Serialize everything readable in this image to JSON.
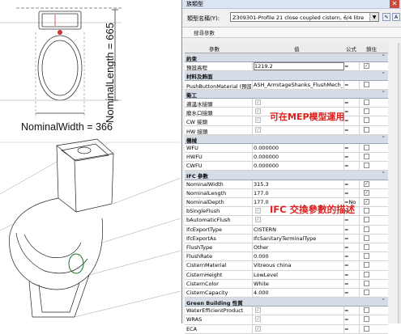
{
  "cad": {
    "nominal_length_label": "NominalLength = 665",
    "nominal_width_label": "NominalWidth = 366"
  },
  "dialog": {
    "title": "族類型",
    "close_glyph": "✕",
    "type_label": "類型名稱(Y):",
    "type_value": "Z309301-Profile 21 close coupled cistern, 6/4 litre",
    "toolbar_label": "搜尋參數",
    "columns": [
      "參數",
      "值",
      "公式",
      "鎖住"
    ]
  },
  "rows": [
    {
      "kind": "group",
      "label": "約束"
    },
    {
      "kind": "param",
      "name": "預設高程",
      "value": "1219.2",
      "formula": "=",
      "lock": true,
      "selected": true
    },
    {
      "kind": "group",
      "label": "材料及飾面"
    },
    {
      "kind": "param",
      "name": "PushButtonMaterial (預設)",
      "value": "ASH_ArmitageShanks_FlushMech_",
      "formula": "=",
      "lock": false
    },
    {
      "kind": "group",
      "label": "衛工"
    },
    {
      "kind": "param",
      "name": "適溫水接頭",
      "valuecb": true,
      "formula": "=",
      "lock": false
    },
    {
      "kind": "param",
      "name": "廢水口接頭",
      "valuecb": true,
      "formula": "=",
      "lock": false
    },
    {
      "kind": "param",
      "name": "CW 接頭",
      "valuecb": true,
      "formula": "=",
      "lock": false
    },
    {
      "kind": "param",
      "name": "HW 接頭",
      "valuecb": true,
      "formula": "=",
      "lock": false
    },
    {
      "kind": "group",
      "label": "機械"
    },
    {
      "kind": "param",
      "name": "WFU",
      "value": "0.000000",
      "formula": "=",
      "lock": false
    },
    {
      "kind": "param",
      "name": "HWFU",
      "value": "0.000000",
      "formula": "=",
      "lock": false
    },
    {
      "kind": "param",
      "name": "CWFU",
      "value": "0.000000",
      "formula": "=",
      "lock": false
    },
    {
      "kind": "group",
      "label": "IFC 參數"
    },
    {
      "kind": "param",
      "name": "NominalWidth",
      "value": "315.3",
      "formula": "=",
      "lock": true
    },
    {
      "kind": "param",
      "name": "NominalLength",
      "value": "177.0",
      "formula": "=",
      "lock": true
    },
    {
      "kind": "param",
      "name": "NominalDepth",
      "value": "177.0",
      "formula": "=No",
      "lock": true
    },
    {
      "kind": "param",
      "name": "bSingleFlush",
      "valuecb": true,
      "formula": "=",
      "lock": false
    },
    {
      "kind": "param",
      "name": "bAutomaticFlush",
      "valuecb": true,
      "formula": "=",
      "lock": false
    },
    {
      "kind": "param",
      "name": "IfcExportType",
      "value": "CISTERN",
      "formula": "=",
      "lock": false
    },
    {
      "kind": "param",
      "name": "IfcExportAs",
      "value": "IfcSanitaryTerminalType",
      "formula": "=",
      "lock": false
    },
    {
      "kind": "param",
      "name": "FlushType",
      "value": "Other",
      "formula": "=",
      "lock": false
    },
    {
      "kind": "param",
      "name": "FlushRate",
      "value": "0.000",
      "formula": "=",
      "lock": false
    },
    {
      "kind": "param",
      "name": "CisternMaterial",
      "value": "Vitreous china",
      "formula": "=",
      "lock": false
    },
    {
      "kind": "param",
      "name": "CisternHeight",
      "value": "LowLevel",
      "formula": "=",
      "lock": false
    },
    {
      "kind": "param",
      "name": "CisternColor",
      "value": "White",
      "formula": "=",
      "lock": false
    },
    {
      "kind": "param",
      "name": "CisternCapacity",
      "value": "4.000",
      "formula": "=",
      "lock": false
    },
    {
      "kind": "group",
      "label": "Green Building 性質"
    },
    {
      "kind": "param",
      "name": "WaterEfficientProduct",
      "valuecb": true,
      "formula": "=",
      "lock": false
    },
    {
      "kind": "param",
      "name": "WRAS",
      "valuecb": true,
      "formula": "=",
      "lock": false
    },
    {
      "kind": "param",
      "name": "ECA",
      "valuecb": true,
      "formula": "=",
      "lock": false
    }
  ],
  "annotations": {
    "mep": "可在MEP模型運用",
    "ifc": "IFC 交換參數的描述"
  },
  "colors": {
    "accent_red": "#e0201c",
    "group_bg": "#d6dde6"
  }
}
